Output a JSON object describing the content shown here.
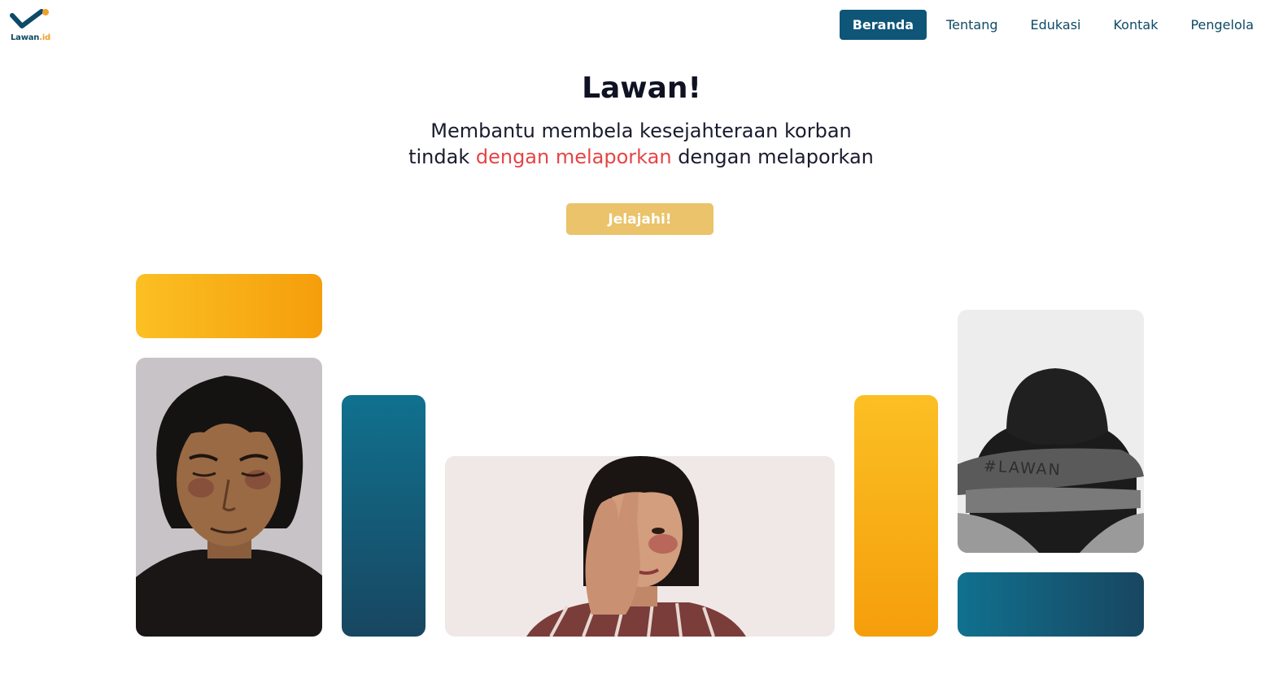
{
  "logo": {
    "name": "Lawan",
    "tld": ".id",
    "accent_color": "#f0a02a",
    "primary_color": "#0d4a66"
  },
  "nav": {
    "items": [
      {
        "label": "Beranda",
        "active": true
      },
      {
        "label": "Tentang",
        "active": false
      },
      {
        "label": "Edukasi",
        "active": false
      },
      {
        "label": "Kontak",
        "active": false
      },
      {
        "label": "Pengelola",
        "active": false
      }
    ]
  },
  "hero": {
    "title": "Lawan!",
    "subtitle_part1": "Membantu membela kesejahteraan korban tindak ",
    "subtitle_highlight": "dengan melaporkan",
    "subtitle_part2": " dengan melaporkan",
    "cta_label": "Jelajahi!",
    "highlight_color": "#e54545",
    "cta_color": "#eac36a"
  },
  "gallery": {
    "photo_left_tattoo": "",
    "photo_right_tattoo": "#LAWAN",
    "accent_yellow": "#fbbf24",
    "accent_teal": "#10718f"
  }
}
